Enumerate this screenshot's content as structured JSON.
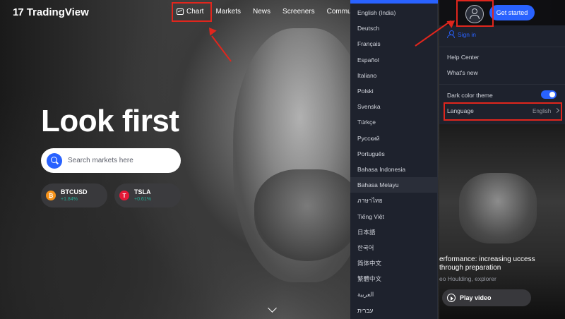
{
  "brand": {
    "logo_mark": "17",
    "name": "TradingView"
  },
  "nav": {
    "items": [
      {
        "label": "Chart"
      },
      {
        "label": "Markets"
      },
      {
        "label": "News"
      },
      {
        "label": "Screeners"
      },
      {
        "label": "Communit"
      }
    ]
  },
  "hero": {
    "headline": "Look first",
    "search_placeholder": "Search markets here"
  },
  "tickers": [
    {
      "symbol": "BTCUSD",
      "change": "+1.84%",
      "icon_letter": "₿",
      "icon_color": "#f7931a"
    },
    {
      "symbol": "TSLA",
      "change": "+0.61%",
      "icon_letter": "T",
      "icon_color": "#e31937"
    }
  ],
  "languages": [
    "English (India)",
    "Deutsch",
    "Français",
    "Español",
    "Italiano",
    "Polski",
    "Svenska",
    "Türkçe",
    "Русский",
    "Português",
    "Bahasa Indonesia",
    "Bahasa Melayu",
    "ภาษาไทย",
    "Tiếng Việt",
    "日本語",
    "한국어",
    "简体中文",
    "繁體中文",
    "العربية",
    "עברית"
  ],
  "highlighted_language": "Bahasa Melayu",
  "user_menu": {
    "get_started": "Get started",
    "sign_in": "Sign in",
    "help_center": "Help Center",
    "whats_new": "What's new",
    "dark_theme": "Dark color theme",
    "dark_theme_on": true,
    "language_label": "Language",
    "language_value": "English"
  },
  "article": {
    "title": "erformance: increasing uccess through preparation",
    "meta": "eo Houlding, explorer",
    "play_label": "Play video"
  },
  "colors": {
    "accent": "#2962ff",
    "annotation": "#e0261d",
    "panel_bg": "#1e222d"
  }
}
